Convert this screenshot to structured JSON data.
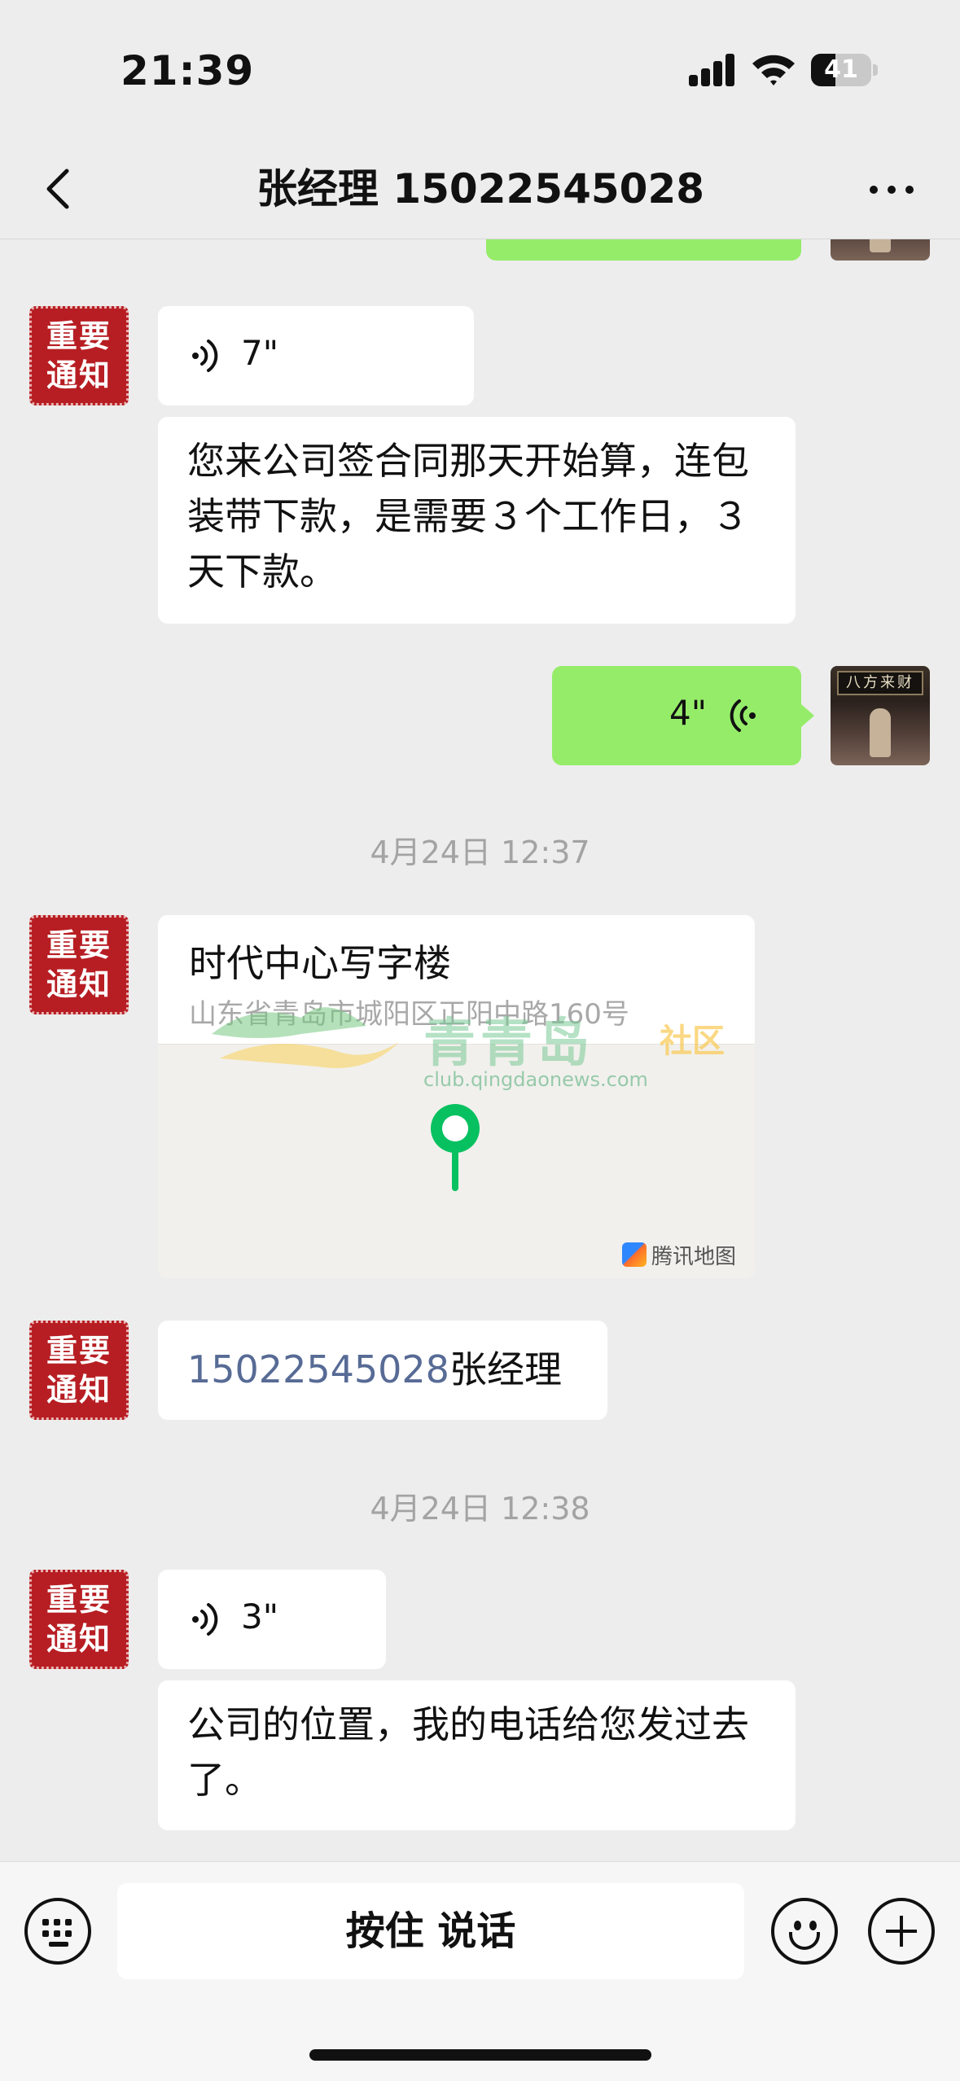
{
  "status_bar": {
    "time": "21:39",
    "battery_level": "41",
    "battery_fraction": 0.41
  },
  "nav": {
    "title": "张经理 15022545028"
  },
  "avatars": {
    "contact_line1": "重要",
    "contact_line2": "通知",
    "self_plaque": "八方来财"
  },
  "messages": [
    {
      "sender": "contact",
      "type": "voice",
      "duration": "7\""
    },
    {
      "sender": "contact",
      "type": "text",
      "text": "您来公司签合同那天开始算，连包装带下款，是需要３个工作日，３天下款。"
    },
    {
      "sender": "self",
      "type": "voice",
      "duration": "4\""
    },
    {
      "type": "timestamp",
      "text": "4月24日 12:37"
    },
    {
      "sender": "contact",
      "type": "location",
      "name": "时代中心写字楼",
      "address": "山东省青岛市城阳区正阳中路160号",
      "provider": "腾讯地图"
    },
    {
      "sender": "contact",
      "type": "contact_text",
      "phone": "15022545028",
      "name": "张经理"
    },
    {
      "type": "timestamp",
      "text": "4月24日 12:38"
    },
    {
      "sender": "contact",
      "type": "voice",
      "duration": "3\""
    },
    {
      "sender": "contact",
      "type": "text",
      "text": "公司的位置，我的电话给您发过去了。"
    }
  ],
  "watermark": {
    "brand": "青青岛",
    "tag": "社区",
    "url": "club.qingdaonews.com"
  },
  "input_bar": {
    "hold_to_talk_label": "按住 说话"
  },
  "colors": {
    "background": "#ededed",
    "self_bubble": "#95ec69",
    "link": "#576b95",
    "notice_avatar": "#b71e23",
    "map_pin": "#07c160"
  }
}
